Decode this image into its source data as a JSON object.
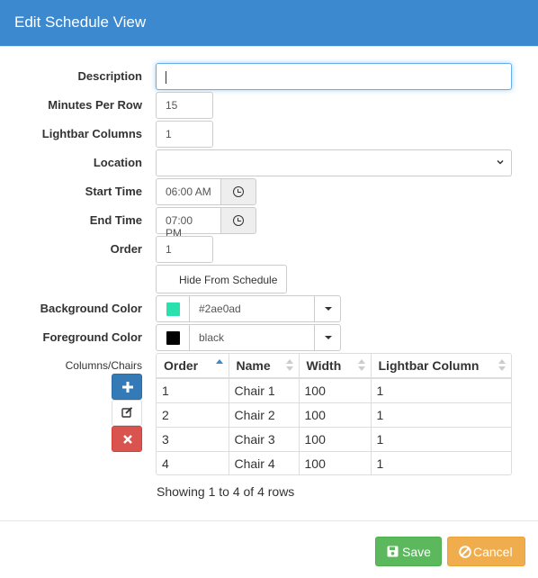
{
  "modal": {
    "title": "Edit Schedule View"
  },
  "form": {
    "description": {
      "label": "Description",
      "value": ""
    },
    "minutes_per_row": {
      "label": "Minutes Per Row",
      "value": "15"
    },
    "lightbar_columns": {
      "label": "Lightbar Columns",
      "value": "1"
    },
    "location": {
      "label": "Location",
      "value": ""
    },
    "start_time": {
      "label": "Start Time",
      "value": "06:00 AM"
    },
    "end_time": {
      "label": "End Time",
      "value": "07:00 PM"
    },
    "order": {
      "label": "Order",
      "value": "1"
    },
    "hide_from_schedule": {
      "label": "Hide From Schedule"
    },
    "background_color": {
      "label": "Background Color",
      "value": "#2ae0ad",
      "swatch": "#2ae0ad"
    },
    "foreground_color": {
      "label": "Foreground Color",
      "value": "black",
      "swatch": "#000000"
    }
  },
  "columns_chairs": {
    "label": "Columns/Chairs",
    "toolbar": {
      "add_icon": "plus-icon",
      "edit_icon": "edit-icon",
      "delete_icon": "times-icon"
    },
    "headers": [
      "Order",
      "Name",
      "Width",
      "Lightbar Column"
    ],
    "rows": [
      {
        "order": "1",
        "name": "Chair 1",
        "width": "100",
        "lightbar": "1"
      },
      {
        "order": "2",
        "name": "Chair 2",
        "width": "100",
        "lightbar": "1"
      },
      {
        "order": "3",
        "name": "Chair 3",
        "width": "100",
        "lightbar": "1"
      },
      {
        "order": "4",
        "name": "Chair 4",
        "width": "100",
        "lightbar": "1"
      }
    ],
    "pagination_text": "Showing 1 to 4 of 4 rows"
  },
  "footer": {
    "save_label": "Save",
    "cancel_label": "Cancel"
  },
  "colors": {
    "header": "#3c89cf",
    "save": "#5cb85c",
    "cancel": "#f0ad4e",
    "add": "#337ab7",
    "delete": "#d9534f"
  }
}
